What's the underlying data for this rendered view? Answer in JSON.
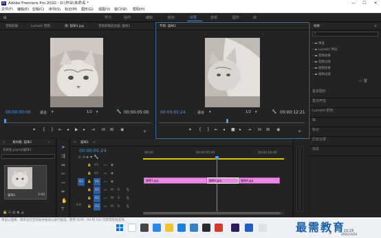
{
  "window": {
    "app_icon": "Pr",
    "title": "Adobe Premiere Pro 2020 - D:\\作业\\未命名 *",
    "minimize": "—",
    "maximize": "☐",
    "close": "✕"
  },
  "menu": [
    "文件(F)",
    "编辑(E)",
    "剪辑(C)",
    "序列(S)",
    "标记(M)",
    "图形(G)",
    "视图(V)",
    "窗口(W)",
    "帮助(H)"
  ],
  "workspaces": [
    "学习",
    "组件",
    "编辑",
    "颜色",
    "效果",
    "音频",
    "图形",
    "库"
  ],
  "active_workspace": "效果",
  "source_monitor": {
    "tabs": [
      "音频剪辑",
      "Lumetri 范围",
      "源: 猫咪3.jpg",
      "音频剪辑混合器: 猫咪1"
    ],
    "active_tab": "源: 猫咪3.jpg",
    "timecode": "00:00:00:00",
    "fit": "适合",
    "fraction": "1/2",
    "duration": "00:00:05:00"
  },
  "program_monitor": {
    "tab": "节目: 猫咪1",
    "timecode": "00:00:05:24",
    "fit": "适合",
    "fraction": "1/2",
    "duration": "00:00:12:21"
  },
  "effects_panel": {
    "title": "效果",
    "folders": [
      "预设",
      "Lumetri 预设",
      "音频效果",
      "音频过渡",
      "视频效果",
      "视频过渡"
    ],
    "sections": [
      "基本图形",
      "基本声音",
      "Lumetri 颜色",
      "库",
      "标记",
      "历史记录",
      "信息"
    ]
  },
  "project_panel": {
    "tab": "素材箱: 猫咪1",
    "path": "未命名.prproj\\猫咪1",
    "item_label": "猫咪1",
    "item_duration": "5:00"
  },
  "timeline": {
    "sequence": "猫咪1",
    "timecode": "00:00:05:24",
    "ruler": [
      "00:00",
      "00:00:05:00",
      "00:00:10:00"
    ],
    "video_tracks": [
      "V3",
      "V2",
      "V1"
    ],
    "audio_tracks": [
      "A1",
      "A2",
      "A3"
    ],
    "source_patch": [
      "V1",
      "A1"
    ],
    "clips": [
      "猫咪1.jpg",
      "猫咪3.jpg",
      "猫咪4.jpg"
    ],
    "mix": "0.0"
  },
  "status_bar": "单击以选择，或单击在空白处并拖动以进行框选。使用 Shift、Alt 和 Ctrl 可获得其他选项。",
  "taskbar": {
    "time": "15:25",
    "date": "2022/3/24",
    "lang": "英"
  },
  "watermark": "最需教育",
  "colors": {
    "accent": "#4f9de9",
    "clip": "#e88ae1",
    "playhead": "#4f9de9"
  }
}
